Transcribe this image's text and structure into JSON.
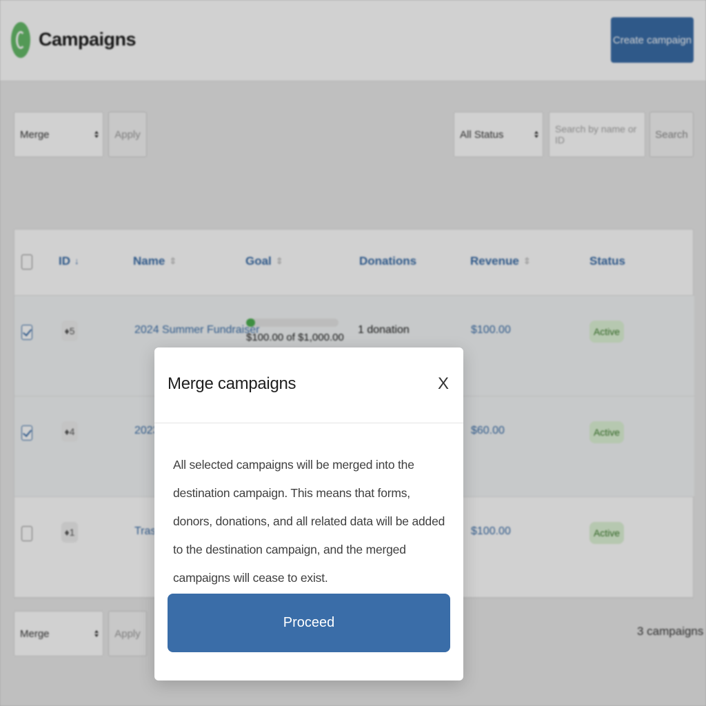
{
  "header": {
    "title": "Campaigns",
    "create_label": "Create campaign",
    "brand_color": "#66bb6a",
    "accent_color": "#3a6da8"
  },
  "bulk_top": {
    "action": "Merge",
    "apply_label": "Apply"
  },
  "filters": {
    "status": "All Status",
    "search_placeholder": "Search by name or ID",
    "search_label": "Search"
  },
  "table": {
    "columns": {
      "id": "ID",
      "name": "Name",
      "goal": "Goal",
      "donations": "Donations",
      "revenue": "Revenue",
      "status": "Status"
    },
    "rows": [
      {
        "selected": true,
        "id": "5",
        "name": "2024 Summer Fundraiser",
        "goal_progress": 0.1,
        "goal_text": "$100.00 of $1,000.00",
        "donations": "1 donation",
        "revenue": "$100.00",
        "status": "Active"
      },
      {
        "selected": true,
        "id": "4",
        "name": "2023",
        "goal_progress": null,
        "goal_text": "",
        "donations": "",
        "revenue": "$60.00",
        "status": "Active"
      },
      {
        "selected": false,
        "id": "1",
        "name": "Trash",
        "goal_progress": null,
        "goal_text": "",
        "donations": "",
        "revenue": "$100.00",
        "status": "Active"
      }
    ]
  },
  "bulk_bottom": {
    "action": "Merge",
    "apply_label": "Apply"
  },
  "footer": {
    "count": "3 campaigns"
  },
  "modal": {
    "title": "Merge campaigns",
    "close_glyph": "X",
    "body": "All selected campaigns will be merged into the destination campaign. This means that forms, donors, donations, and all related data will be added to the destination campaign, and the merged campaigns will cease to exist.",
    "proceed_label": "Proceed"
  }
}
